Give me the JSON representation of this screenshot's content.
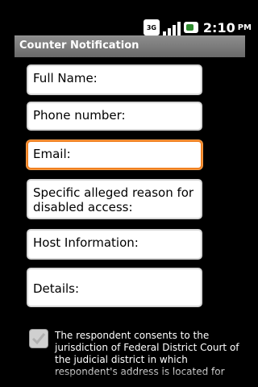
{
  "status_bar": {
    "network_label": "3G",
    "time": "2:10",
    "ampm": "PM"
  },
  "title_bar": {
    "title": "Counter Notification"
  },
  "form": {
    "fields": [
      {
        "label": "Full Name:"
      },
      {
        "label": "Phone number:"
      },
      {
        "label": "Email:"
      },
      {
        "label": "Specific alleged reason for disabled access:"
      },
      {
        "label": "Host Information:"
      },
      {
        "label": "Details:"
      }
    ],
    "consent_text": "The respondent consents to the jurisdiction of Federal District Court of the judicial district in which respondent's address is located for"
  }
}
